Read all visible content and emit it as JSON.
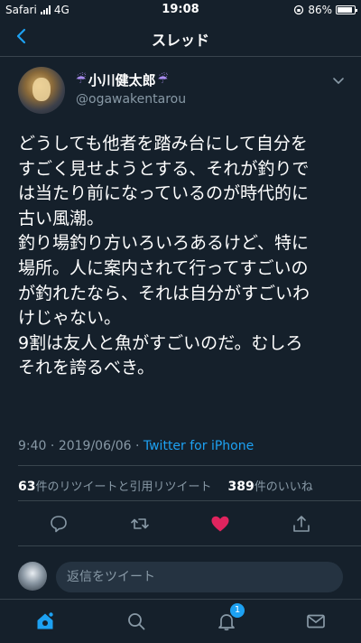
{
  "status": {
    "carrier": "Safari",
    "network": "4G",
    "time": "19:08",
    "battery": "86%"
  },
  "nav": {
    "title": "スレッド"
  },
  "tweet": {
    "display_name": "小川健太郎",
    "name_emoji_left": "☔",
    "name_emoji_right": "☔",
    "handle": "@ogawakentarou",
    "lines": [
      "どうしても他者を踏み台にして自分を",
      "すごく見せようとする、それが釣りで",
      "は当たり前になっているのが時代的に",
      "古い風潮。",
      "釣り場釣り方いろいろあるけど、特に",
      "場所。人に案内されて行ってすごいの",
      "が釣れたなら、それは自分がすごいわ",
      "けじゃない。",
      "9割は友人と魚がすごいのだ。むしろ",
      "それを誇るべき。"
    ],
    "time": "9:40",
    "date": "2019/06/06",
    "client": "Twitter for iPhone",
    "retweet_count": "63",
    "retweet_label": "件のリツイートと引用リツイート",
    "like_count": "389",
    "like_label": "件のいいね",
    "liked": true
  },
  "reply": {
    "placeholder": "返信をツイート"
  },
  "tabs": {
    "notifications_badge": "1"
  },
  "colors": {
    "accent": "#1da1f2",
    "like": "#e0245e",
    "background": "#15202b",
    "muted": "#8899a6"
  }
}
